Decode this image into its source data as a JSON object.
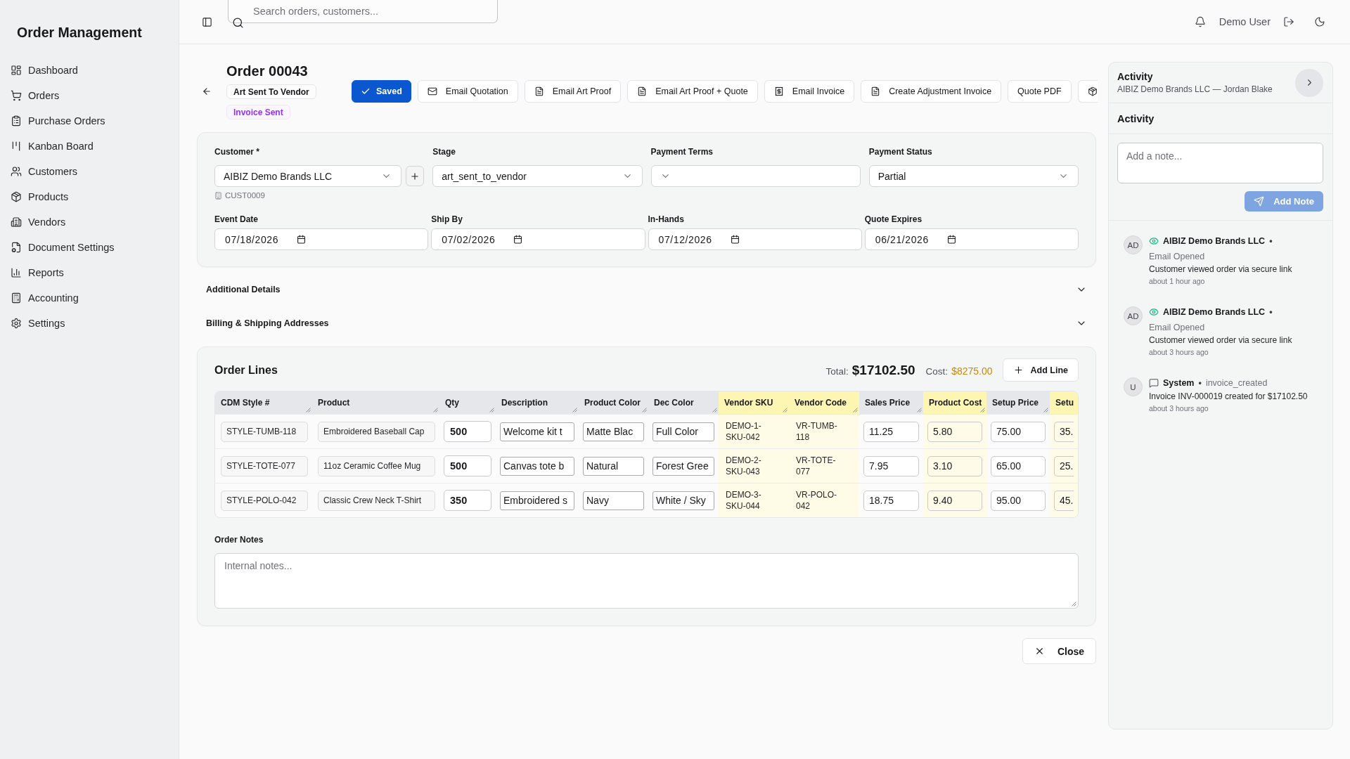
{
  "sidebar": {
    "title": "Order Management",
    "items": [
      {
        "label": "Dashboard",
        "selected": false
      },
      {
        "label": "Orders",
        "selected": false
      },
      {
        "label": "Purchase Orders",
        "selected": false
      },
      {
        "label": "Kanban Board",
        "selected": false
      },
      {
        "label": "Customers",
        "selected": false
      },
      {
        "label": "Products",
        "selected": false
      },
      {
        "label": "Vendors",
        "selected": false
      },
      {
        "label": "Document Settings",
        "selected": false
      },
      {
        "label": "Reports",
        "selected": false
      },
      {
        "label": "Accounting",
        "selected": false
      },
      {
        "label": "Settings",
        "selected": false
      }
    ]
  },
  "header": {
    "search": {
      "placeholder": "Search orders, customers..."
    },
    "user": "Demo User"
  },
  "order": {
    "title": "Order 00043",
    "badges": [
      {
        "label": "Art Sent To Vendor",
        "kind": "stage"
      },
      {
        "label": "Invoice Sent",
        "kind": "invoice"
      }
    ],
    "actions": [
      {
        "label": "Saved",
        "kind": "primary"
      },
      {
        "label": "Email Quotation",
        "kind": "outline"
      },
      {
        "label": "Email Art Proof",
        "kind": "outline"
      },
      {
        "label": "Email Art Proof + Quote",
        "kind": "outline"
      },
      {
        "label": "Email Invoice",
        "kind": "outline"
      },
      {
        "label": "Create Adjustment Invoice",
        "kind": "outline"
      },
      {
        "label": "Quote PDF",
        "kind": "outline"
      },
      {
        "kind": "outline"
      }
    ]
  },
  "details": {
    "customer": {
      "label": "Customer *",
      "value": "AIBIZ Demo Brands LLC",
      "code": "CUST0009"
    },
    "stage": {
      "label": "Stage",
      "value": "art_sent_to_vendor"
    },
    "payment_terms": {
      "label": "Payment Terms"
    },
    "payment_status": {
      "label": "Payment Status",
      "value": "Partial"
    },
    "dates": [
      {
        "label": "Event Date",
        "value": "07/18/2026"
      },
      {
        "label": "Ship By",
        "value": "07/02/2026"
      },
      {
        "label": "In-Hands",
        "value": "07/12/2026"
      },
      {
        "label": "Quote Expires",
        "value": "06/21/2026"
      }
    ]
  },
  "sections": [
    {
      "title": "Additional Details",
      "expanded": false
    },
    {
      "title": "Billing & Shipping Addresses",
      "expanded": false
    }
  ],
  "order_lines": {
    "title": "Order Lines",
    "total_label": "Total:",
    "total": "$17102.50",
    "cost_label": "Cost:",
    "cost": "$8275.00",
    "add_button": "Add Line",
    "columns": [
      {
        "label": "CDM Style #",
        "kind": "code",
        "highlighted": false
      },
      {
        "label": "Product",
        "kind": "code",
        "highlighted": false
      },
      {
        "label": "Qty",
        "kind": "qty",
        "highlighted": false
      },
      {
        "label": "Description",
        "kind": "input",
        "highlighted": false
      },
      {
        "label": "Product Color",
        "kind": "input",
        "highlighted": false
      },
      {
        "label": "Dec Color",
        "kind": "input",
        "highlighted": false
      },
      {
        "label": "Vendor SKU",
        "kind": "text",
        "highlighted": true
      },
      {
        "label": "Vendor Code",
        "kind": "text",
        "highlighted": true
      },
      {
        "label": "Sales Price",
        "kind": "price",
        "highlighted": false
      },
      {
        "label": "Product Cost",
        "kind": "price",
        "highlighted": true
      },
      {
        "label": "Setup Price",
        "kind": "price",
        "highlighted": false
      },
      {
        "label": "Setu",
        "kind": "price",
        "highlighted": true
      }
    ],
    "rows": [
      {
        "cells": [
          "STYLE-TUMB-118",
          "Embroidered Baseball Cap",
          "500",
          "Welcome kit t",
          "Matte Blac",
          "Full Color",
          "DEMO-1-SKU-042",
          "VR-TUMB-118",
          "11.25",
          "5.80",
          "75.00",
          "35."
        ]
      },
      {
        "cells": [
          "STYLE-TOTE-077",
          "11oz Ceramic Coffee Mug",
          "500",
          "Canvas tote b",
          "Natural",
          "Forest Gree",
          "DEMO-2-SKU-043",
          "VR-TOTE-077",
          "7.95",
          "3.10",
          "65.00",
          "25."
        ]
      },
      {
        "cells": [
          "STYLE-POLO-042",
          "Classic Crew Neck T-Shirt",
          "350",
          "Embroidered s",
          "Navy",
          "White / Sky",
          "DEMO-3-SKU-044",
          "VR-POLO-042",
          "18.75",
          "9.40",
          "95.00",
          "45."
        ]
      }
    ]
  },
  "notes": {
    "label": "Order Notes",
    "placeholder": "Internal notes..."
  },
  "close_button": "Close",
  "activity": {
    "title": "Activity",
    "subtitle": "AIBIZ Demo Brands LLC — Jordan Blake",
    "section_title": "Activity",
    "note": {
      "placeholder": "Add a note..."
    },
    "add_button": {
      "label": "Add Note",
      "disabled": true
    },
    "entries": [
      {
        "kind": "email",
        "avatar": "AD",
        "author": "AIBIZ Demo Brands LLC",
        "separator": "•",
        "event": "Email Opened",
        "message": "Customer viewed order via secure link",
        "time": "about 1 hour ago"
      },
      {
        "kind": "email",
        "avatar": "AD",
        "author": "AIBIZ Demo Brands LLC",
        "separator": "•",
        "event": "Email Opened",
        "message": "Customer viewed order via secure link",
        "time": "about 3 hours ago"
      },
      {
        "kind": "system",
        "avatar": "U",
        "author": "System",
        "separator": "•",
        "tag": "invoice_created",
        "message": "Invoice INV-000019 created for $17102.50",
        "time": "about 3 hours ago"
      }
    ]
  }
}
